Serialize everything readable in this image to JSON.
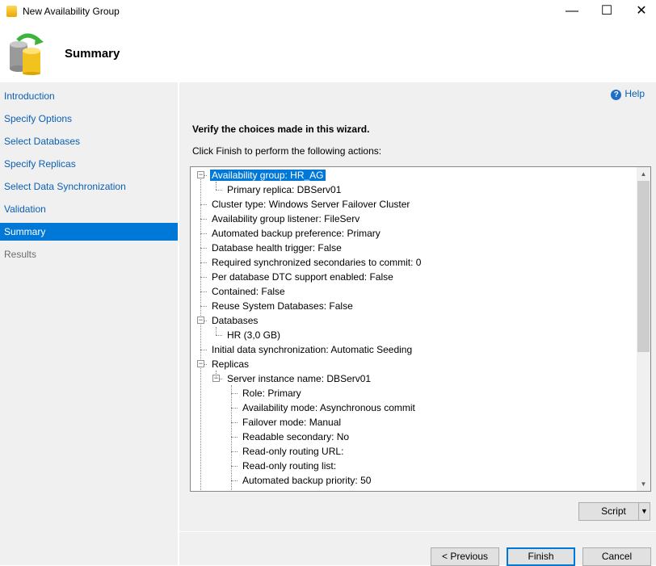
{
  "window": {
    "title": "New Availability Group",
    "minimize": "—",
    "maximize": "☐",
    "close": "✕"
  },
  "header": {
    "title": "Summary"
  },
  "nav": {
    "items": [
      {
        "label": "Introduction",
        "state": "link"
      },
      {
        "label": "Specify Options",
        "state": "link"
      },
      {
        "label": "Select Databases",
        "state": "link"
      },
      {
        "label": "Specify Replicas",
        "state": "link"
      },
      {
        "label": "Select Data Synchronization",
        "state": "link"
      },
      {
        "label": "Validation",
        "state": "link"
      },
      {
        "label": "Summary",
        "state": "selected"
      },
      {
        "label": "Results",
        "state": "disabled"
      }
    ]
  },
  "main": {
    "help": "Help",
    "verify": "Verify the choices made in this wizard.",
    "instruction": "Click Finish to perform the following actions:",
    "tree": [
      {
        "text": "Availability group: HR_AG",
        "level": 0,
        "expander": true,
        "selected": true
      },
      {
        "text": "Primary replica: DBServ01",
        "level": 1
      },
      {
        "text": "Cluster type: Windows Server Failover Cluster",
        "level": 0
      },
      {
        "text": "Availability group listener: FileServ",
        "level": 0
      },
      {
        "text": "Automated backup preference: Primary",
        "level": 0
      },
      {
        "text": "Database health trigger: False",
        "level": 0
      },
      {
        "text": "Required synchronized secondaries to commit: 0",
        "level": 0
      },
      {
        "text": "Per database DTC support enabled: False",
        "level": 0
      },
      {
        "text": "Contained: False",
        "level": 0
      },
      {
        "text": "Reuse System Databases: False",
        "level": 0
      },
      {
        "text": "Databases",
        "level": 0,
        "expander": true
      },
      {
        "text": "HR (3,0 GB)",
        "level": 1
      },
      {
        "text": "Initial data synchronization: Automatic Seeding",
        "level": 0
      },
      {
        "text": "Replicas",
        "level": 0,
        "expander": true
      },
      {
        "text": "Server instance name: DBServ01",
        "level": 1,
        "expander": true
      },
      {
        "text": "Role: Primary",
        "level": 2
      },
      {
        "text": "Availability mode: Asynchronous commit",
        "level": 2
      },
      {
        "text": "Failover mode: Manual",
        "level": 2
      },
      {
        "text": "Readable secondary: No",
        "level": 2
      },
      {
        "text": "Read-only routing URL:",
        "level": 2
      },
      {
        "text": "Read-only routing list:",
        "level": 2
      },
      {
        "text": "Automated backup priority: 50",
        "level": 2
      }
    ],
    "script": "Script",
    "previous": "< Previous",
    "finish": "Finish",
    "cancel": "Cancel"
  }
}
